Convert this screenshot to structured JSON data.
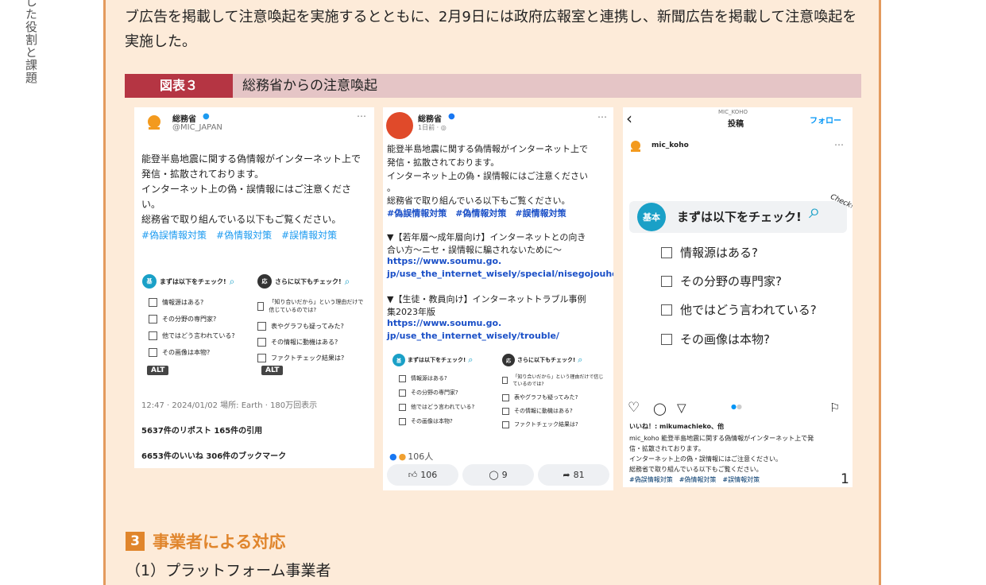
{
  "side_text": "した役割と課題",
  "paragraph": "ブ広告を掲載して注意喚起を実施するとともに、2月9日には政府広報室と連携し、新聞広告を掲載して注意喚起を実施した。",
  "figure": {
    "label": "図表３",
    "title": "総務省からの注意喚起"
  },
  "tweet": {
    "name": "総務省",
    "handle": "@MIC_JAPAN",
    "lines": [
      "能登半島地震に関する偽情報がインターネット上で",
      "発信・拡散されております。",
      "インターネット上の偽・誤情報にはご注意くださ",
      "い。",
      "総務省で取り組んでいる以下もご覧ください。"
    ],
    "hashtags": "#偽誤情報対策　#偽情報対策　#誤情報対策",
    "img1_head": "まずは以下をチェック!",
    "img1_items": [
      "情報源はある?",
      "その分野の専門家?",
      "他ではどう言われている?",
      "その画像は本物?"
    ],
    "img2_head": "さらに以下もチェック!",
    "img2_items": [
      "「知り合いだから」という理由だけで信じているのでは?",
      "表やグラフも疑ってみた?",
      "その情報に動機はある?",
      "ファクトチェック結果は?"
    ],
    "alt": "ALT",
    "meta": "12:47 · 2024/01/02 場所: Earth · 180万回表示",
    "reposts": "5637件のリポスト  165件の引用",
    "likes": "6653件のいいね  306件のブックマーク"
  },
  "fb_post": {
    "name": "総務省",
    "time": "1日前 · ◎",
    "lines": [
      "能登半島地震に関する偽情報がインターネット上で",
      "発信・拡散されております。",
      "インターネット上の偽・誤情報にはご注意ください",
      "。",
      "総務省で取り組んでいる以下もご覧ください。"
    ],
    "hashtags": "#偽誤情報対策　#偽情報対策　#誤情報対策",
    "item1_lines": [
      "▼【若年層～成年層向け】インターネットとの向き",
      "合い方～ニセ・誤情報に騙されないために～"
    ],
    "link1_lines": [
      "https://www.soumu.go.",
      "jp/use_the_internet_wisely/special/nisegojouhou/"
    ],
    "item2_lines": [
      "▼【生徒・教員向け】インターネットトラブル事例",
      "集2023年版"
    ],
    "link2_lines": [
      "https://www.soumu.go.",
      "jp/use_the_internet_wisely/trouble/"
    ],
    "reactions": "106人",
    "like_count": "106",
    "comment_count": "9",
    "share_count": "81"
  },
  "ig_post": {
    "header_small": "MIC_KOHO",
    "header": "投稿",
    "follow": "フォロー",
    "account": "mic_koho",
    "badge": "基本",
    "check_title": "まずは以下をチェック!",
    "check_word": "Check!",
    "items": [
      "情報源はある?",
      "その分野の専門家?",
      "他ではどう言われている?",
      "その画像は本物?"
    ],
    "likes": "いいね！: mikumachieko、他",
    "caption_lines": [
      "mic_koho 能登半島地震に関する偽情報がインターネット上で発",
      "信・拡散されております。",
      "インターネット上の偽・誤情報にはご注意ください。",
      "総務省で取り組んでいる以下もご覧ください。"
    ],
    "hashtags": "#偽誤情報対策　#偽情報対策　#誤情報対策"
  },
  "page_number": "1",
  "section": {
    "number": "3",
    "title": "事業者による対応"
  },
  "subsection": "（1）プラットフォーム事業者"
}
